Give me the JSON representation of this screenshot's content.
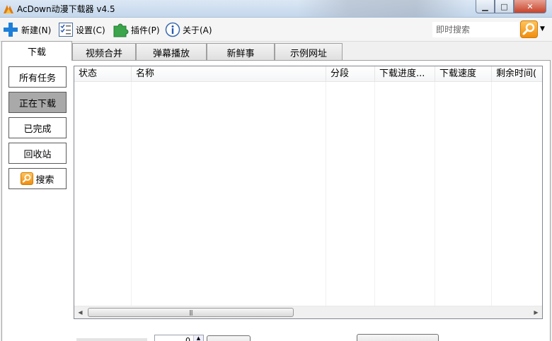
{
  "window": {
    "title": "AcDown动漫下载器 v4.5"
  },
  "toolbar": {
    "new_label": "新建(N)",
    "settings_label": "设置(C)",
    "plugins_label": "插件(P)",
    "about_label": "关于(A)",
    "search_placeholder": "即时搜索"
  },
  "tabs": [
    {
      "label": "下载",
      "active": true
    },
    {
      "label": "视频合并",
      "active": false
    },
    {
      "label": "弹幕播放",
      "active": false
    },
    {
      "label": "新鲜事",
      "active": false
    },
    {
      "label": "示例网址",
      "active": false
    }
  ],
  "sidebar": {
    "items": [
      {
        "label": "所有任务",
        "active": false
      },
      {
        "label": "正在下载",
        "active": true
      },
      {
        "label": "已完成",
        "active": false
      },
      {
        "label": "回收站",
        "active": false
      },
      {
        "label": "搜索",
        "active": false,
        "icon": "search-icon"
      }
    ]
  },
  "task_list": {
    "columns": [
      "状态",
      "名称",
      "分段",
      "下载进度...",
      "下载速度",
      "剩余时间("
    ],
    "rows": []
  },
  "bottom": {
    "spin_value": "0"
  },
  "colors": {
    "accent_orange": "#f08d10",
    "active_filter": "#a9a9a9",
    "plus_blue": "#1e7fd8",
    "plugin_green": "#3aa54a"
  }
}
